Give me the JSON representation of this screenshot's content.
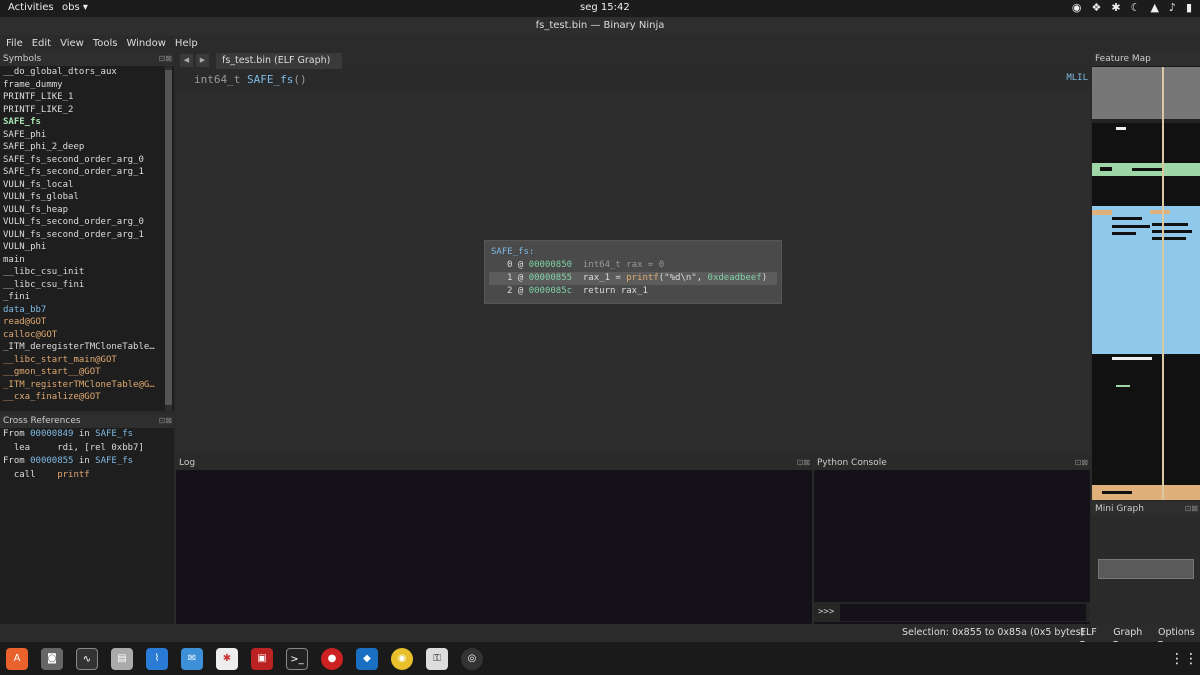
{
  "topbar": {
    "activities": "Activities",
    "app": "obs ▾",
    "clock": "seg 15:42"
  },
  "window": {
    "title": "fs_test.bin — Binary Ninja"
  },
  "menu": {
    "items": [
      "File",
      "Edit",
      "View",
      "Tools",
      "Window",
      "Help"
    ]
  },
  "symbols": {
    "title": "Symbols",
    "items": [
      "__do_global_dtors_aux",
      "frame_dummy",
      "PRINTF_LIKE_1",
      "PRINTF_LIKE_2",
      "SAFE_fs",
      "SAFE_phi",
      "SAFE_phi_2_deep",
      "SAFE_fs_second_order_arg_0",
      "SAFE_fs_second_order_arg_1",
      "VULN_fs_local",
      "VULN_fs_global",
      "VULN_fs_heap",
      "VULN_fs_second_order_arg_0",
      "VULN_fs_second_order_arg_1",
      "VULN_phi",
      "main",
      "__libc_csu_init",
      "__libc_csu_fini",
      "_fini",
      "data_bb7",
      "read@GOT",
      "calloc@GOT",
      "_ITM_deregisterTMCloneTable…",
      "__libc_start_main@GOT",
      "__gmon_start__@GOT",
      "_ITM_registerTMCloneTable@G…",
      "__cxa_finalize@GOT"
    ],
    "active": "SAFE_fs"
  },
  "xrefs": {
    "title": "Cross References",
    "from_label": "From",
    "in_label": "in",
    "rows": [
      {
        "addr": "00000849",
        "func": "SAFE_fs",
        "op": "lea",
        "args": "rdi, [rel 0xbb7]"
      },
      {
        "addr": "00000855",
        "func": "SAFE_fs",
        "op": "call",
        "args": "printf"
      }
    ]
  },
  "tab": {
    "label": "fs_test.bin (ELF Graph)"
  },
  "graph": {
    "signature_type": "int64_t",
    "signature_name": "SAFE_fs",
    "signature_parens": "()",
    "il_label": "MLIL",
    "block_label": "SAFE_fs:",
    "lines": [
      {
        "idx": "0",
        "addr": "00000850",
        "text": "int64_t rax = 0"
      },
      {
        "idx": "1",
        "addr": "00000855",
        "text_pre": "rax_1 = ",
        "call": "printf",
        "text_args": "(\"%d\\n\", ",
        "hex": "0xdeadbeef",
        "text_post": ")"
      },
      {
        "idx": "2",
        "addr": "0000085c",
        "text": "return rax_1"
      }
    ]
  },
  "log": {
    "title": "Log"
  },
  "python": {
    "title": "Python Console",
    "prompt": ">>>"
  },
  "featuremap": {
    "title": "Feature Map"
  },
  "minigraph": {
    "title": "Mini Graph"
  },
  "status": {
    "selection": "Selection: 0x855 to 0x85a (0x5 bytes)",
    "elf": "ELF ▾",
    "graph": "Graph ▾",
    "options": "Options ▾"
  },
  "colors": {
    "accent_blue": "#7fb9e3",
    "accent_green": "#a6e1b0",
    "accent_orange": "#e0a970"
  }
}
